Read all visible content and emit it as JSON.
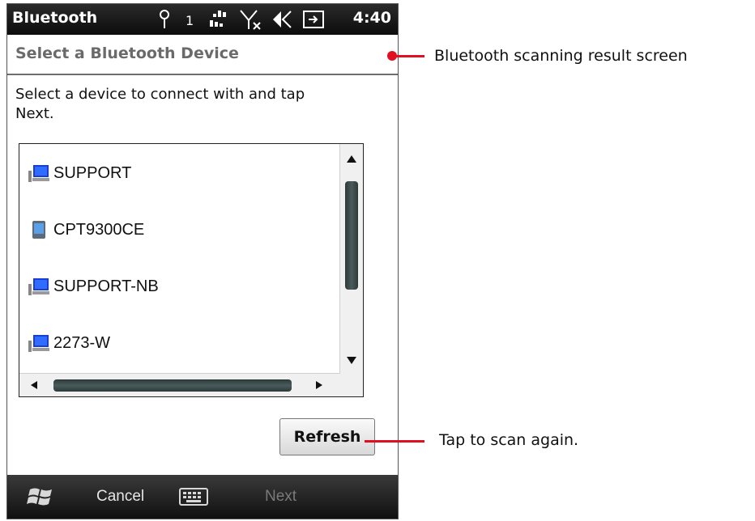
{
  "status_bar": {
    "app_title": "Bluetooth",
    "clock": "4:40",
    "icons": [
      "antenna-icon",
      "sync-icon",
      "no-signal-icon",
      "speaker-mute-icon",
      "battery-charging-icon"
    ],
    "signal_label": "1"
  },
  "header": {
    "title": "Select a Bluetooth Device"
  },
  "instruction": "Select a device to connect with and tap Next.",
  "devices": [
    {
      "label": "SUPPORT",
      "icon": "computer-icon"
    },
    {
      "label": "CPT9300CE",
      "icon": "pda-icon"
    },
    {
      "label": "SUPPORT-NB",
      "icon": "computer-icon"
    },
    {
      "label": "2273-W",
      "icon": "computer-icon"
    }
  ],
  "buttons": {
    "refresh": "Refresh"
  },
  "taskbar": {
    "cancel": "Cancel",
    "next": "Next"
  },
  "annotations": {
    "scan_result": "Bluetooth scanning result screen",
    "refresh_hint": "Tap to scan again."
  },
  "colors": {
    "annotation": "#e01020",
    "status_bar": "#1a1a1a",
    "header_text": "#6a6a6a"
  }
}
